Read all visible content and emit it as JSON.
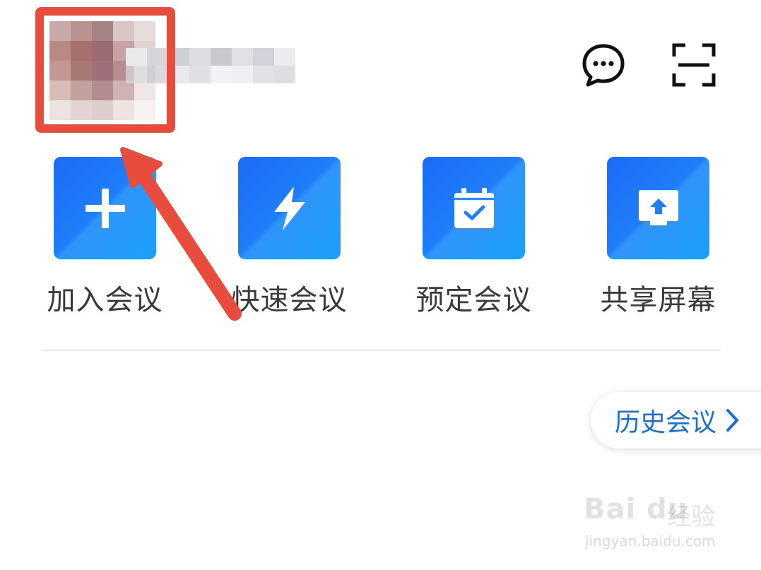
{
  "header": {
    "avatar_icon": "avatar-blurred",
    "username_icon": "username-blurred",
    "message_icon": "chat-bubble-icon",
    "scan_icon": "scan-icon"
  },
  "actions": [
    {
      "id": "join",
      "label": "加入会议",
      "icon": "plus-icon"
    },
    {
      "id": "quick",
      "label": "快速会议",
      "icon": "lightning-icon"
    },
    {
      "id": "schedule",
      "label": "预定会议",
      "icon": "calendar-check-icon"
    },
    {
      "id": "share",
      "label": "共享屏幕",
      "icon": "share-screen-icon"
    }
  ],
  "history": {
    "label": "历史会议",
    "icon": "chevron-right-icon"
  },
  "watermark": {
    "logo_text": "Bai du",
    "name": "经验",
    "url": "jingyan.baidu.com"
  },
  "colors": {
    "accent": "#1a6fd6",
    "tile_blue": "#1f7ef9",
    "annotation_red": "#e84c3c"
  }
}
